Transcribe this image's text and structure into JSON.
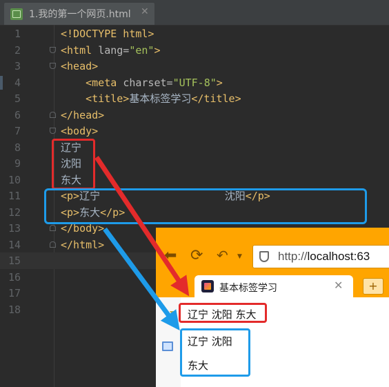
{
  "editor": {
    "tab_title": "1.我的第一个网页.html",
    "current_line": 15,
    "lines": [
      {
        "n": "1",
        "tokens": [
          [
            "tag",
            "<!DOCTYPE html>"
          ]
        ]
      },
      {
        "n": "2",
        "tokens": [
          [
            "tag",
            "<html "
          ],
          [
            "attr",
            "lang="
          ],
          [
            "val",
            "\"en\""
          ],
          [
            "tag",
            ">"
          ]
        ]
      },
      {
        "n": "3",
        "tokens": [
          [
            "tag",
            "<head>"
          ]
        ]
      },
      {
        "n": "4",
        "tokens": [
          [
            "txt",
            "    "
          ],
          [
            "tag",
            "<meta "
          ],
          [
            "attr",
            "charset="
          ],
          [
            "val",
            "\"UTF-8\""
          ],
          [
            "tag",
            ">"
          ]
        ]
      },
      {
        "n": "5",
        "tokens": [
          [
            "txt",
            "    "
          ],
          [
            "tag",
            "<title>"
          ],
          [
            "txt",
            "基本标签学习"
          ],
          [
            "tag",
            "</title>"
          ]
        ]
      },
      {
        "n": "6",
        "tokens": [
          [
            "tag",
            "</head>"
          ]
        ]
      },
      {
        "n": "7",
        "tokens": [
          [
            "tag",
            "<body>"
          ]
        ]
      },
      {
        "n": "8",
        "tokens": [
          [
            "txt",
            "辽宁"
          ]
        ]
      },
      {
        "n": "9",
        "tokens": [
          [
            "txt",
            "沈阳"
          ]
        ]
      },
      {
        "n": "10",
        "tokens": [
          [
            "txt",
            "东大"
          ]
        ]
      },
      {
        "n": "11",
        "tokens": [
          [
            "tag",
            "<p>"
          ],
          [
            "txt",
            "辽宁                    沈阳"
          ],
          [
            "tag",
            "</p>"
          ]
        ]
      },
      {
        "n": "12",
        "tokens": [
          [
            "tag",
            "<p>"
          ],
          [
            "txt",
            "东大"
          ],
          [
            "tag",
            "</p>"
          ]
        ]
      },
      {
        "n": "13",
        "tokens": [
          [
            "tag",
            "</body>"
          ]
        ]
      },
      {
        "n": "14",
        "tokens": [
          [
            "tag",
            "</html>"
          ]
        ]
      },
      {
        "n": "15",
        "tokens": []
      },
      {
        "n": "16",
        "tokens": []
      },
      {
        "n": "17",
        "tokens": []
      },
      {
        "n": "18",
        "tokens": []
      }
    ]
  },
  "browser": {
    "url_prefix": "http://",
    "url_host": "localhost:63",
    "tab_title": "基本标签学习",
    "tab_close": "✕",
    "new_tab": "+",
    "output_line1": "辽宁 沈阳 东大",
    "output_p1": "辽宁 沈阳",
    "output_p2": "东大"
  },
  "colors": {
    "annotation_red": "#e32b2b",
    "annotation_blue": "#1e9be9",
    "browser_chrome": "#ffa500"
  }
}
